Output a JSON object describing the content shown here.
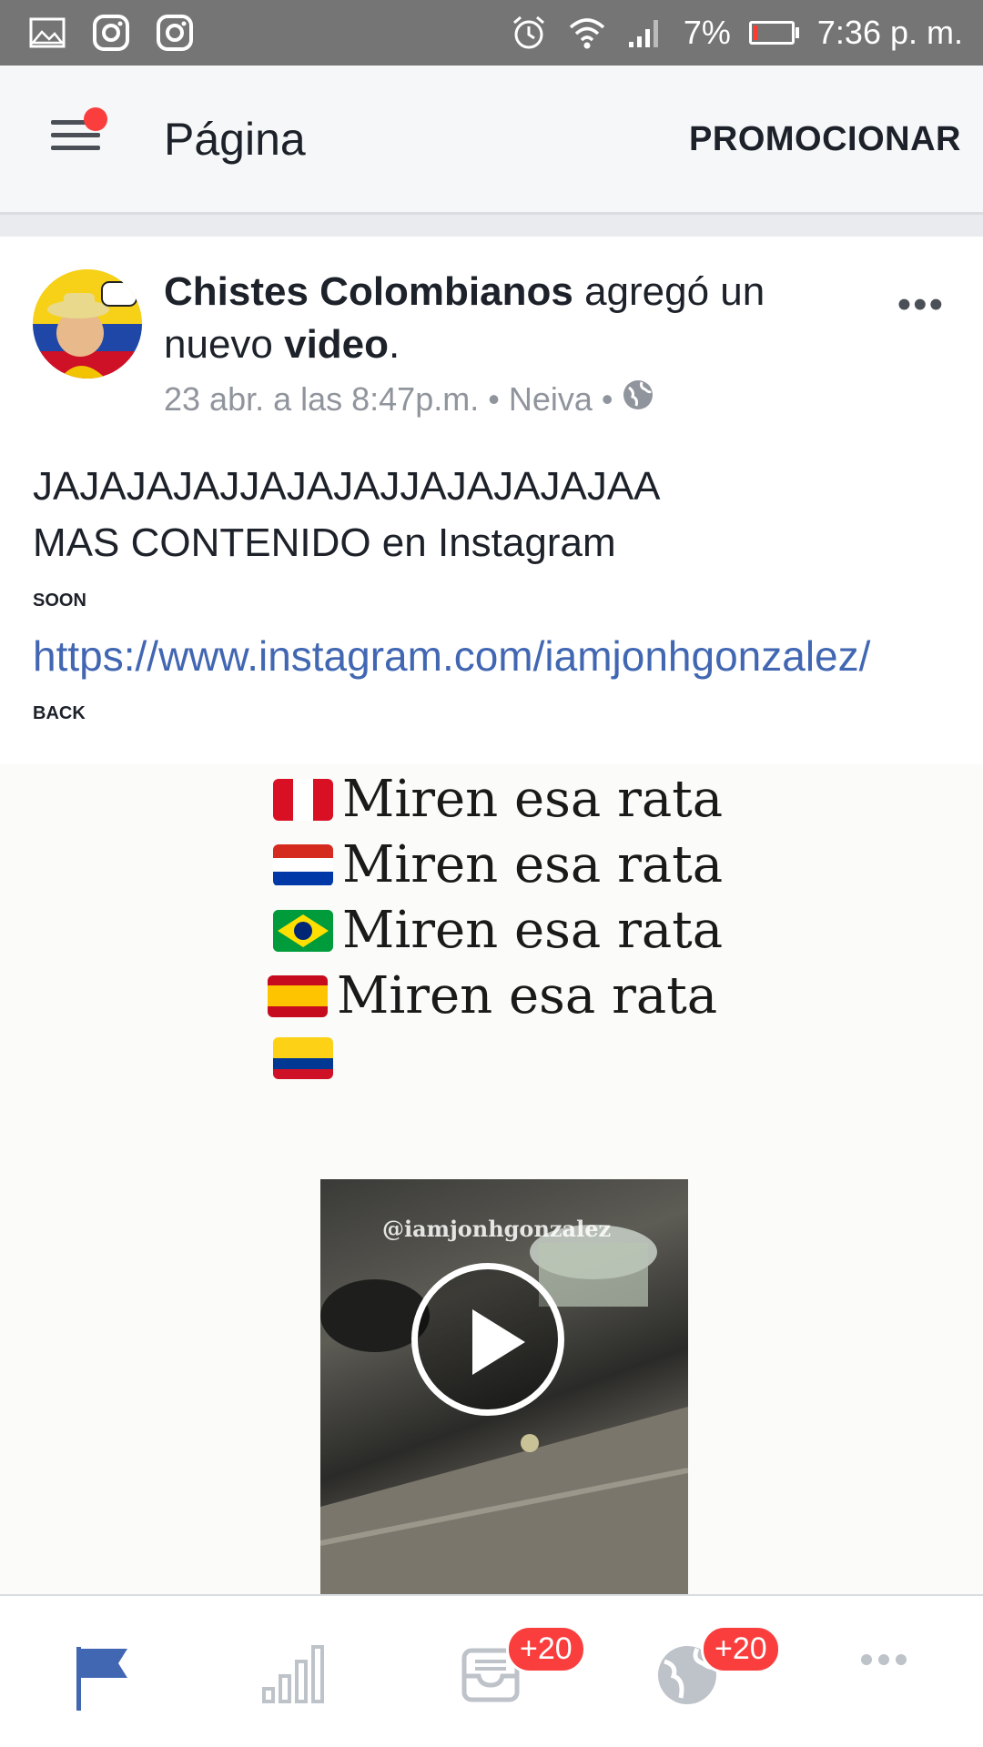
{
  "status_bar": {
    "battery_percent": "7%",
    "time": "7:36 p. m.",
    "icons": [
      "gallery-icon",
      "instagram-icon",
      "instagram-icon",
      "alarm-icon",
      "wifi-icon",
      "signal-icon",
      "battery-icon"
    ]
  },
  "header": {
    "title": "Página",
    "promote_label": "PROMOCIONAR",
    "has_notification_dot": true
  },
  "post": {
    "page_name": "Chistes Colombianos",
    "action_text_1": " agregó un nuevo ",
    "action_object": "video",
    "action_end": ".",
    "timestamp": "23 abr. a las 8:47p.m.",
    "location": "Neiva",
    "sep": "•",
    "body_line_1": "JAJAJAJAJJAJAJAJJAJAJAJAJAA",
    "body_line_2": "MAS CONTENIDO en Instagram",
    "soon_label": "SOON",
    "link": "https://www.instagram.com/iamjonhgonzalez/",
    "back_label": "BACK",
    "media": {
      "caption_lines": [
        "Miren esa rata",
        "Miren esa rata",
        "Miren esa rata",
        "Miren esa rata"
      ],
      "watermark": "@iamjonhgonzalez"
    }
  },
  "bottom_nav": {
    "items": [
      {
        "name": "page-flag",
        "active": true
      },
      {
        "name": "insights",
        "active": false
      },
      {
        "name": "inbox",
        "badge": "+20"
      },
      {
        "name": "notifications-globe",
        "badge": "+20"
      },
      {
        "name": "more"
      }
    ]
  },
  "colors": {
    "accent": "#4267b2",
    "badge": "#fa3e3e",
    "status_bar": "#757575",
    "header_bg": "#f6f7f9"
  }
}
